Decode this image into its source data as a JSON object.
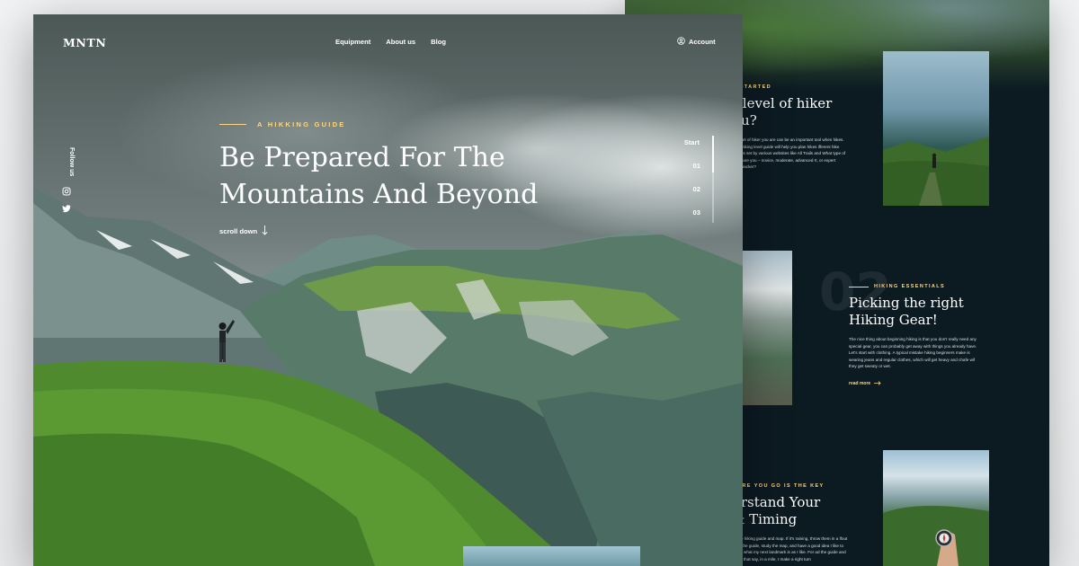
{
  "nav": {
    "logo": "MNTN",
    "links": [
      "Equipment",
      "About us",
      "Blog"
    ],
    "account": "Account"
  },
  "social": {
    "follow_label": "Follow us",
    "icons": [
      "instagram-icon",
      "twitter-icon"
    ]
  },
  "hero": {
    "kicker": "A HIKKING GUIDE",
    "title": "Be Prepared For The Mountains And Beyond",
    "scroll_label": "scroll down"
  },
  "pager": {
    "items": [
      "Start",
      "01",
      "02",
      "03"
    ],
    "active_index": 0
  },
  "sections": [
    {
      "kicker": "T STARTED",
      "title_line1": "t level of hiker",
      "title_line2": "ou?",
      "body": "at level of hiker you are can be an important tool when hikes. This hiking level guide will help you plan hikes ifferent hike ratings set by various websites like All Trails and What type of hiker are you – novice, moderate, advanced rt, or expert backpacker?"
    },
    {
      "number": "02",
      "kicker": "HIKING ESSENTIALS",
      "title_line1": "Picking the right",
      "title_line2": "Hiking Gear!",
      "body": "The nice thing about beginning hiking is that you don't really need any special gear, you can probably get away with things you already have. Let's start with clothing. A typical mistake hiking beginners make is wearing jeans and regular clothes, which will get heavy and chafe wif they get sweaty or wet.",
      "read_more": "read more"
    },
    {
      "kicker": "HERE YOU GO IS THE KEY",
      "title_line1": "erstand Your",
      "title_line2": "& Timing",
      "body": "ut the hiking guide and map. If it's raining, throw them in a lfout over the guide, study the map, and have a good idea I like to know what my next landmark is as I like. For ad the guide and know that say, in a mile, I make a right turn"
    }
  ],
  "colors": {
    "accent": "#fbd784",
    "dark_bg": "#0c1a22",
    "text_light": "#ffffff"
  }
}
